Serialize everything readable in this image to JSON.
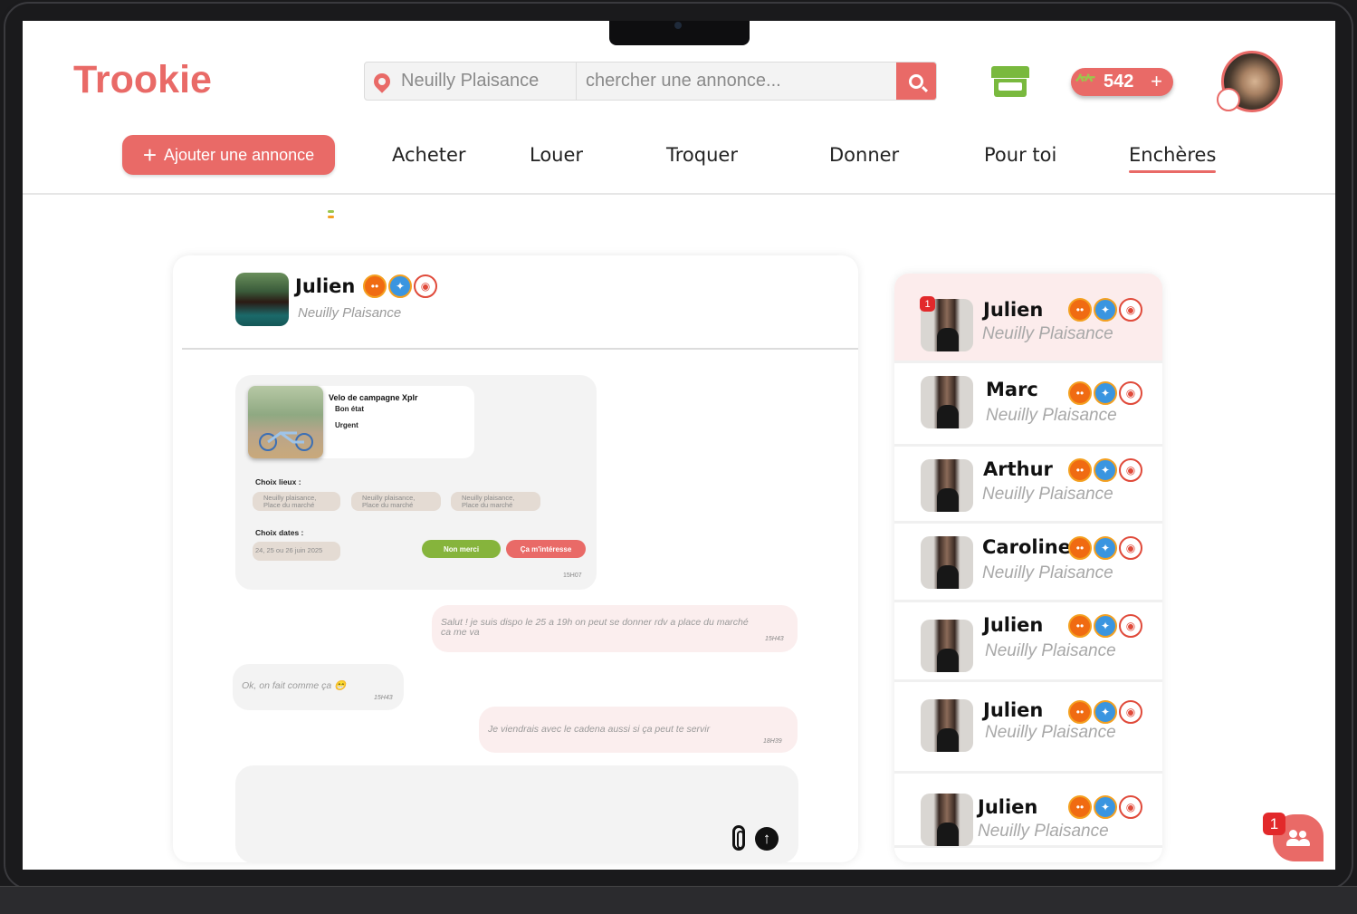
{
  "app": {
    "logo": "Trookie",
    "accent": "#e96a67"
  },
  "header": {
    "location": "Neuilly Plaisance",
    "search_placeholder": "chercher une annonce...",
    "coins": "542",
    "coins_plus": "+"
  },
  "nav": {
    "add_label": "Ajouter une annonce",
    "items": [
      "Acheter",
      "Louer",
      "Troquer",
      "Donner",
      "Pour toi",
      "Enchères"
    ],
    "active": "Enchères"
  },
  "chat": {
    "name": "Julien",
    "location": "Neuilly Plaisance",
    "offer": {
      "title": "Velo de campagne Xplr",
      "condition": "Bon état",
      "urgency": "Urgent",
      "places_label": "Choix lieux  :",
      "places": [
        "Neuilly plaisance,\nPlace du marché",
        "Neuilly plaisance,\nPlace du marché",
        "Neuilly plaisance,\nPlace du marché"
      ],
      "dates_label": "Choix dates  :",
      "dates": "24, 25 ou 26 juin 2025",
      "decline": "Non merci",
      "accept": "Ça m'intéresse",
      "time": "15H07"
    },
    "messages": [
      {
        "from": "me",
        "text": "Salut ! je suis dispo le 25 a 19h on peut se donner rdv a place du marché ca me va",
        "time": "15H43"
      },
      {
        "from": "them",
        "text": "Ok, on fait comme ça 😁",
        "time": "15H43"
      },
      {
        "from": "me",
        "text": "Je viendrais avec le cadena aussi si ça peut te servir",
        "time": "18H39"
      }
    ]
  },
  "contacts": [
    {
      "name": "Julien",
      "location": "Neuilly Plaisance",
      "unread": "1",
      "selected": true
    },
    {
      "name": "Marc",
      "location": "Neuilly Plaisance"
    },
    {
      "name": "Arthur",
      "location": "Neuilly Plaisance"
    },
    {
      "name": "Caroline",
      "location": "Neuilly Plaisance"
    },
    {
      "name": "Julien",
      "location": "Neuilly Plaisance"
    },
    {
      "name": "Julien",
      "location": "Neuilly Plaisance"
    },
    {
      "name": "Julien",
      "location": "Neuilly Plaisance"
    }
  ],
  "fab": {
    "badge": "1",
    "icon": "group-icon"
  }
}
